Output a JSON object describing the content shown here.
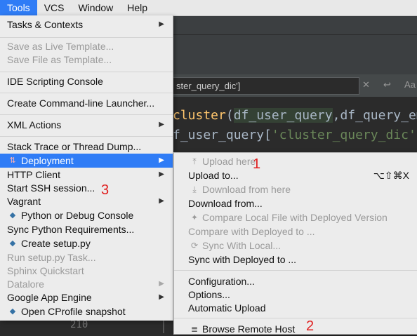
{
  "menubar": {
    "items": [
      "Tools",
      "VCS",
      "Window",
      "Help"
    ]
  },
  "editor": {
    "search_text": "ster_query_dic']",
    "line1": [
      "cluster",
      "(",
      "df_user_query",
      ",",
      "df_query_em"
    ],
    "line2": [
      "f_user_query[",
      "'cluster_query_dic'"
    ],
    "line_number": "210"
  },
  "tools_menu": {
    "tasks": "Tasks & Contexts",
    "save_live_template": "Save as Live Template...",
    "save_file_template": "Save File as Template...",
    "ide_scripting": "IDE Scripting Console",
    "cmdline_launcher": "Create Command-line Launcher...",
    "xml_actions": "XML Actions",
    "stack_trace": "Stack Trace or Thread Dump...",
    "deployment": "Deployment",
    "http_client": "HTTP Client",
    "ssh": "Start SSH session...",
    "vagrant": "Vagrant",
    "python_console": "Python or Debug Console",
    "sync_requirements": "Sync Python Requirements...",
    "create_setup": "Create setup.py",
    "run_setup": "Run setup.py Task...",
    "sphinx": "Sphinx Quickstart",
    "datalore": "Datalore",
    "app_engine": "Google App Engine",
    "cprofile": "Open CProfile snapshot"
  },
  "deployment_menu": {
    "upload_here": "Upload here",
    "upload_to": "Upload to...",
    "upload_to_shortcut": "⌥⇧⌘X",
    "download_here": "Download from here",
    "download_from": "Download from...",
    "compare_local": "Compare Local File with Deployed Version",
    "compare_deployed": "Compare with Deployed to ...",
    "sync_local": "Sync With Local...",
    "sync_deployed": "Sync with Deployed to ...",
    "configuration": "Configuration...",
    "options": "Options...",
    "auto_upload": "Automatic Upload",
    "browse_remote": "Browse Remote Host"
  },
  "annotations": {
    "one": "1",
    "two": "2",
    "three": "3"
  },
  "colors": {
    "selection": "#2f7cf6",
    "annotation": "#e02020"
  }
}
